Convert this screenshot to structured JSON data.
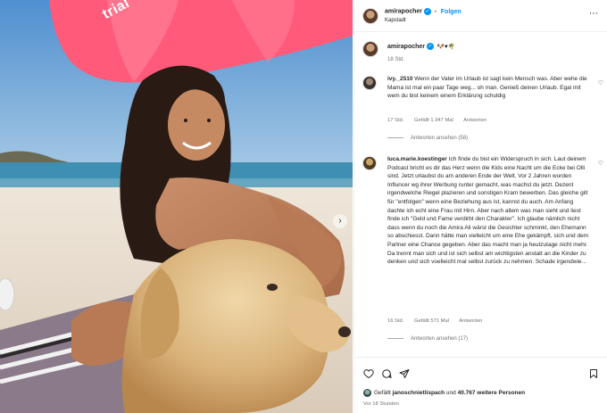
{
  "photo": {
    "umbrella_brand_text": "trial",
    "carousel_next_glyph": "›",
    "colors": {
      "sky": "#6fa6d6",
      "umbrella": "#ff5a7a",
      "sand": "#e9dfd2",
      "sea": "#3f8fb2",
      "dog": "#d9b27a"
    }
  },
  "header": {
    "username": "amirapocher",
    "verified": "✓",
    "separator": "•",
    "follow_label": "Folgen",
    "location": "Kapstadt",
    "more_icon": "⋯"
  },
  "caption": {
    "username": "amirapocher",
    "verified": "✓",
    "emojis": "🐶♥🌴",
    "time": "18 Std."
  },
  "comments": [
    {
      "username": "ivy._2510",
      "text": "Wenn der Vater im Urlaub ist sagt kein Mensch was. Aber wehe die Mama ist mal ein paar Tage weg... oh man. Genieß deinen Urlaub. Egal mit wem du bist keinem einem Erklärung schuldig",
      "time": "17 Std.",
      "likes": "Gefällt 1.947 Mal",
      "reply": "Antworten",
      "replies": "Antworten ansehen (58)",
      "heart_icon": "♡"
    },
    {
      "username": "luca.marie.koestinger",
      "text": "Ich finde du bist ein Widerspruch in sich. Laut deinem Podcast bricht es dir das Herz wenn die Kids eine Nacht um die Ecke bei Olli sind. Jetzt urlaubst du am anderen Ende der Welt. Vor 2 Jahren wurden Influncer wg ihrer Werbung runter gemacht, was machst du jetzt. Dezent irgendwelche Riegel plazieren und sonstigen Kram bewerben. Das gleiche gilt für \"entfolgen\" wenn eine Beziehung aus ist, kannst du auch. Am Anfang dachte ich echt eine Frau mit Hirn. Aber nach allem was man sieht und liest finde ich \"Geld und Fame verdirbt den Charakter\". Ich glaube nämlich nicht dass wenn du noch die Amira Ali wärst die Gesichter schminkt, den Ehemann so abschiesst. Dann hätte man vielleicht um eine Ehe gekämpft, sich und dem Partner eine Chance gegeben. Aber das macht man ja heutzutage nicht mehr. Da trennt man sich und ist sich selbst am wichtigsten anstatt an die Kinder zu denken und sich voelleicht mal selbst zurück zu nehmen. Schade irgendwie...",
      "time": "16 Std.",
      "likes": "Gefällt 571 Mal",
      "reply": "Antworten",
      "replies": "Antworten ansehen (17)",
      "heart_icon": "♡"
    }
  ],
  "actions": {
    "like_icon": "heart-icon",
    "comment_icon": "comment-icon",
    "share_icon": "send-icon",
    "save_icon": "bookmark-icon"
  },
  "likes_line": {
    "prefix": "Gefällt ",
    "first_user": "janoschnietlispach",
    "middle": " und ",
    "others": "40.767 weitere Personen"
  },
  "post_time": "Vor 18 Stunden"
}
